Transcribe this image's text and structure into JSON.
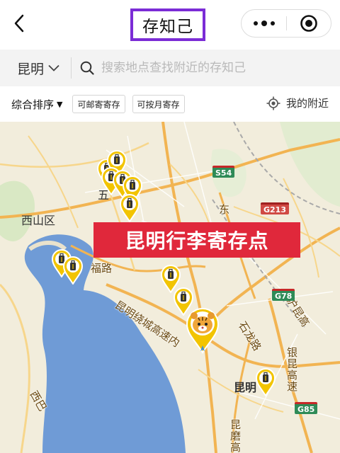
{
  "header": {
    "title": "存知己",
    "back_icon": "chevron-left-icon",
    "more_icon": "more-dots-icon",
    "close_icon": "target-circle-icon"
  },
  "search": {
    "city": "昆明",
    "placeholder": "搜索地点查找附近的存知己"
  },
  "filters": {
    "sort_label": "综合排序",
    "sort_arrow": "▼",
    "chips": [
      "可邮寄寄存",
      "可按月寄存"
    ],
    "nearby_label": "我的附近"
  },
  "map": {
    "banner": "昆明行李寄存点",
    "labels": {
      "xishan": "西山区",
      "wu": "五",
      "kunming": "昆明"
    },
    "roads": {
      "fulu": "福路",
      "ring": "昆明绕城高速内",
      "dong": "东",
      "shilong": "石龙路",
      "yinkun": "银昆高速",
      "hukun": "沪昆高",
      "kunmo": "昆磨高",
      "xisa": "西巴"
    },
    "shields": {
      "s54": "S54",
      "g213": "G213",
      "g78": "G78",
      "g85": "G85"
    }
  },
  "colors": {
    "accent_purple": "#7b2cd6",
    "banner_red": "#e0283b",
    "pin_yellow": "#f2c400",
    "water": "#6f9bd6"
  }
}
